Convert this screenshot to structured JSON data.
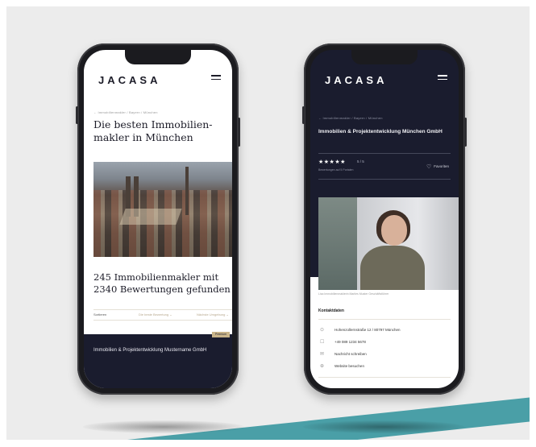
{
  "left_phone": {
    "logo": "JACASA",
    "breadcrumb": "← Immobilienmakler / Bayern / München",
    "heading": "Die besten Immobilien-makler in München",
    "results_heading": "245 Immobilienmakler mit 2340 Bewertungen gefunden",
    "filter": {
      "sort_label": "Sortieren",
      "option_1": "Die beste Bewertung ⌄",
      "option_2": "Nächste Umgebung ⌄"
    },
    "card": {
      "badge": "Premium",
      "title": "Immobilien & Projektentwicklung Mustername GmbH"
    }
  },
  "right_phone": {
    "logo": "JACASA",
    "breadcrumb": "← Immobilienmakler / Bayern / München",
    "company_title": "Immobilien & Projektentwicklung München GmbH",
    "rating": {
      "stars": "★★★★★",
      "score": "5 / 5",
      "reviews": "Bewertungen auf 5 Portalen"
    },
    "favorite_label": "Favoriten",
    "photo_caption": "Lisa Immobilienmaklerin Marlies Muster Geschäftsführer",
    "contact": {
      "heading": "Kontaktdaten",
      "items": [
        {
          "icon": "⊙",
          "text": "Hohenzollernstraße 12 / 80797 München"
        },
        {
          "icon": "☐",
          "text": "+49 089 1234 5678"
        },
        {
          "icon": "✉",
          "text": "Nachricht schreiben"
        },
        {
          "icon": "⊕",
          "text": "Website besuchen"
        }
      ]
    }
  },
  "colors": {
    "navy": "#1a1c2e",
    "gold": "#c9b48a",
    "teal": "#4a9fa7",
    "background": "#ececec"
  }
}
